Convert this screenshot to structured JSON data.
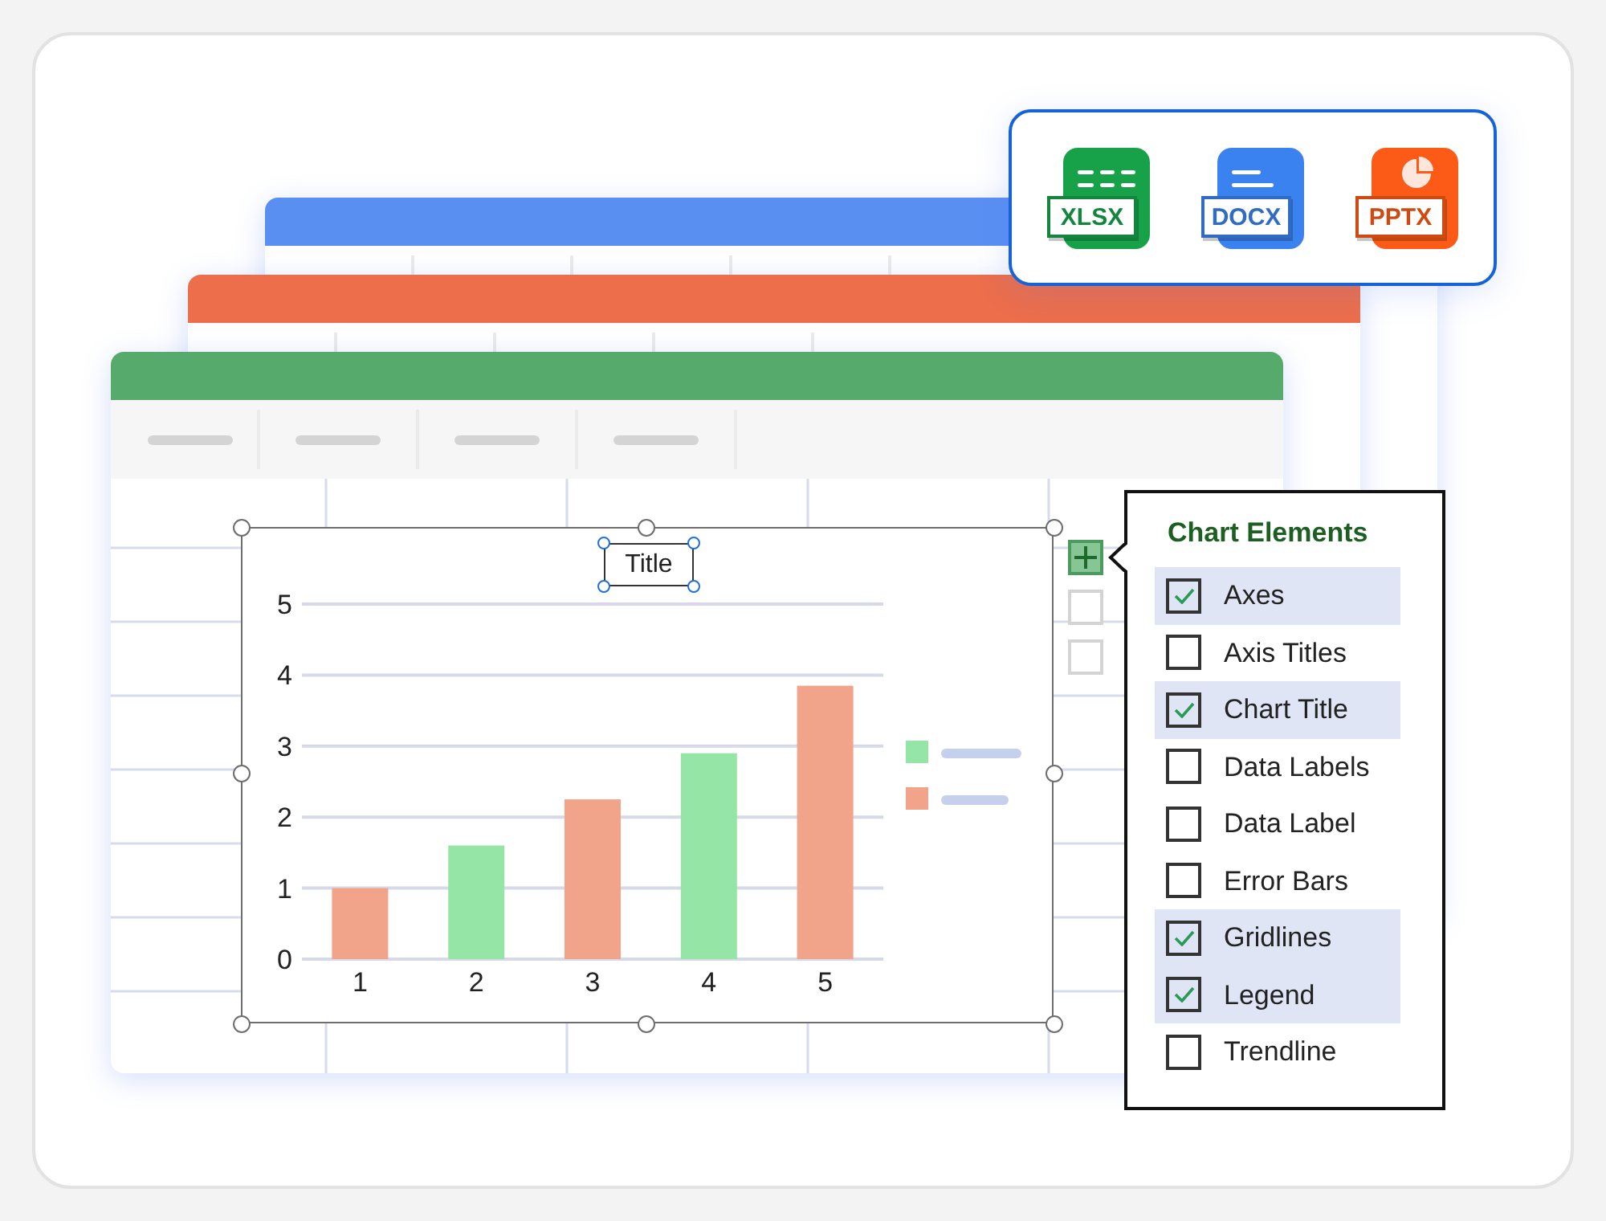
{
  "file_formats": [
    {
      "kind": "spreadsheet",
      "label": "XLSX",
      "color": "#17a24a"
    },
    {
      "kind": "document",
      "label": "DOCX",
      "color": "#3a82f0"
    },
    {
      "kind": "presentation",
      "label": "PPTX",
      "color": "#fc5a17"
    }
  ],
  "windows": [
    {
      "color": "#5a8ff2"
    },
    {
      "color": "#ec6e4b"
    },
    {
      "color": "#56aa6b"
    }
  ],
  "chart": {
    "chart_data": {
      "type": "bar",
      "title": "Title",
      "categories": [
        "1",
        "2",
        "3",
        "4",
        "5"
      ],
      "series": [
        {
          "color": "#95e5a6",
          "values": [
            null,
            1.6,
            null,
            2.9,
            null
          ]
        },
        {
          "color": "#f2a48a",
          "values": [
            1.0,
            null,
            2.25,
            null,
            3.85
          ]
        }
      ],
      "stacked": true,
      "grid": true,
      "ylim": [
        0,
        5
      ],
      "yticks": [
        0,
        1,
        2,
        3,
        4,
        5
      ]
    }
  },
  "chart_buttons": [
    {
      "kind": "add",
      "selected": true
    },
    {
      "kind": "blank",
      "selected": false
    },
    {
      "kind": "blank",
      "selected": false
    }
  ],
  "chart_elements": {
    "title": "Chart Elements",
    "items": [
      {
        "label": "Axes",
        "checked": true
      },
      {
        "label": "Axis Titles",
        "checked": false
      },
      {
        "label": "Chart Title",
        "checked": true
      },
      {
        "label": "Data Labels",
        "checked": false
      },
      {
        "label": "Data Label",
        "checked": false
      },
      {
        "label": "Error Bars",
        "checked": false
      },
      {
        "label": "Gridlines",
        "checked": true
      },
      {
        "label": "Legend",
        "checked": true
      },
      {
        "label": "Trendline",
        "checked": false
      }
    ]
  }
}
